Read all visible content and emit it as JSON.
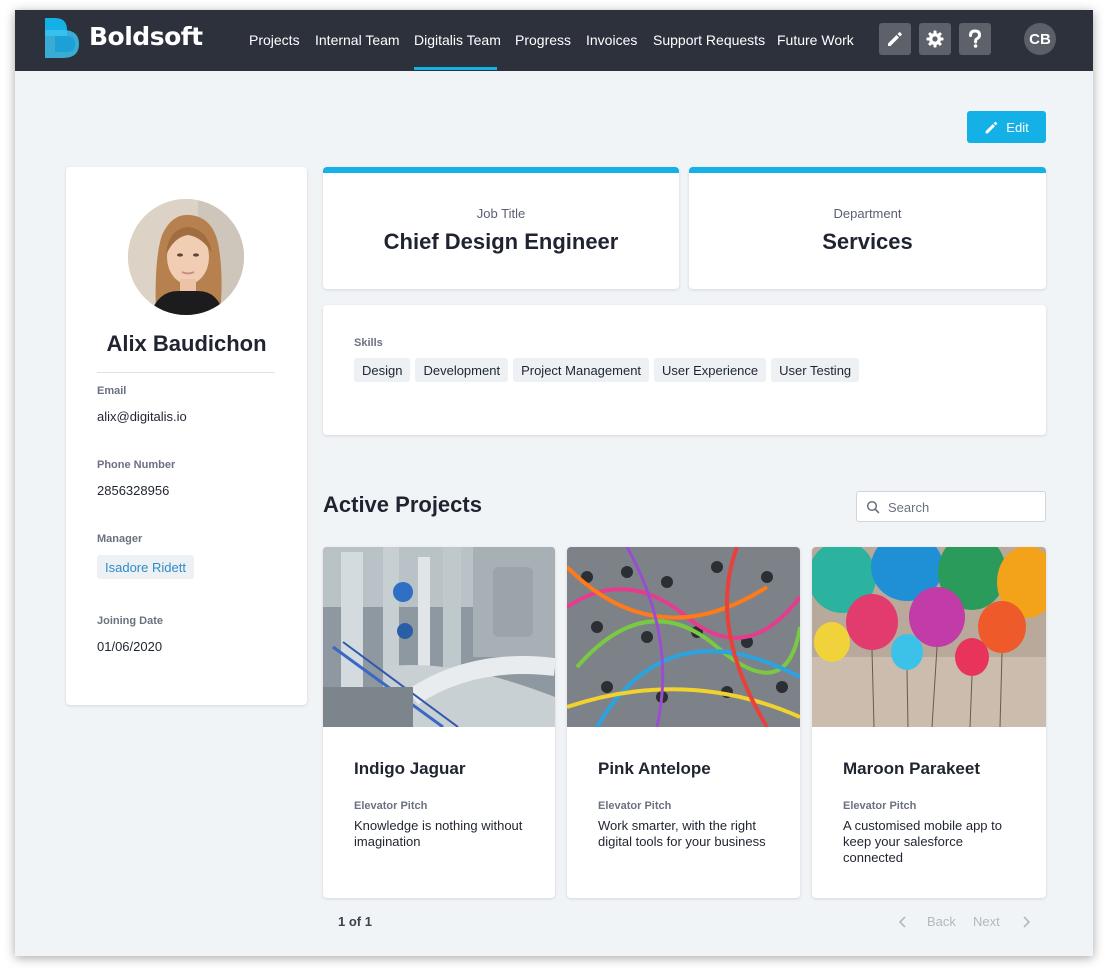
{
  "app": {
    "brand": "Boldsoft",
    "accent_color": "#14b1e7",
    "topbar_color": "#2c313c"
  },
  "nav": {
    "items": [
      {
        "label": "Projects"
      },
      {
        "label": "Internal Team"
      },
      {
        "label": "Digitalis Team",
        "active": true
      },
      {
        "label": "Progress"
      },
      {
        "label": "Invoices"
      },
      {
        "label": "Support Requests"
      },
      {
        "label": "Future Work"
      }
    ],
    "tools": [
      "pencil-icon",
      "gear-icon",
      "question-icon"
    ],
    "user_initials": "CB"
  },
  "actions": {
    "edit_label": "Edit"
  },
  "profile": {
    "name": "Alix Baudichon",
    "email_label": "Email",
    "email": "alix@digitalis.io",
    "phone_label": "Phone Number",
    "phone": "2856328956",
    "manager_label": "Manager",
    "manager": "Isadore Ridett",
    "joining_label": "Joining Date",
    "joining_date": "01/06/2020"
  },
  "job": {
    "label": "Job Title",
    "value": "Chief Design Engineer"
  },
  "department": {
    "label": "Department",
    "value": "Services"
  },
  "skills": {
    "label": "Skills",
    "items": [
      "Design",
      "Development",
      "Project Management",
      "User Experience",
      "User Testing"
    ]
  },
  "projects": {
    "title": "Active Projects",
    "search_placeholder": "Search",
    "pitch_label": "Elevator Pitch",
    "items": [
      {
        "name": "Indigo Jaguar",
        "pitch": "Knowledge is nothing without imagination"
      },
      {
        "name": "Pink Antelope",
        "pitch": "Work smarter, with the right digital tools for your business"
      },
      {
        "name": "Maroon Parakeet",
        "pitch": "A customised mobile app to keep your salesforce connected"
      }
    ]
  },
  "pagination": {
    "count": "1 of 1",
    "back": "Back",
    "next": "Next"
  }
}
